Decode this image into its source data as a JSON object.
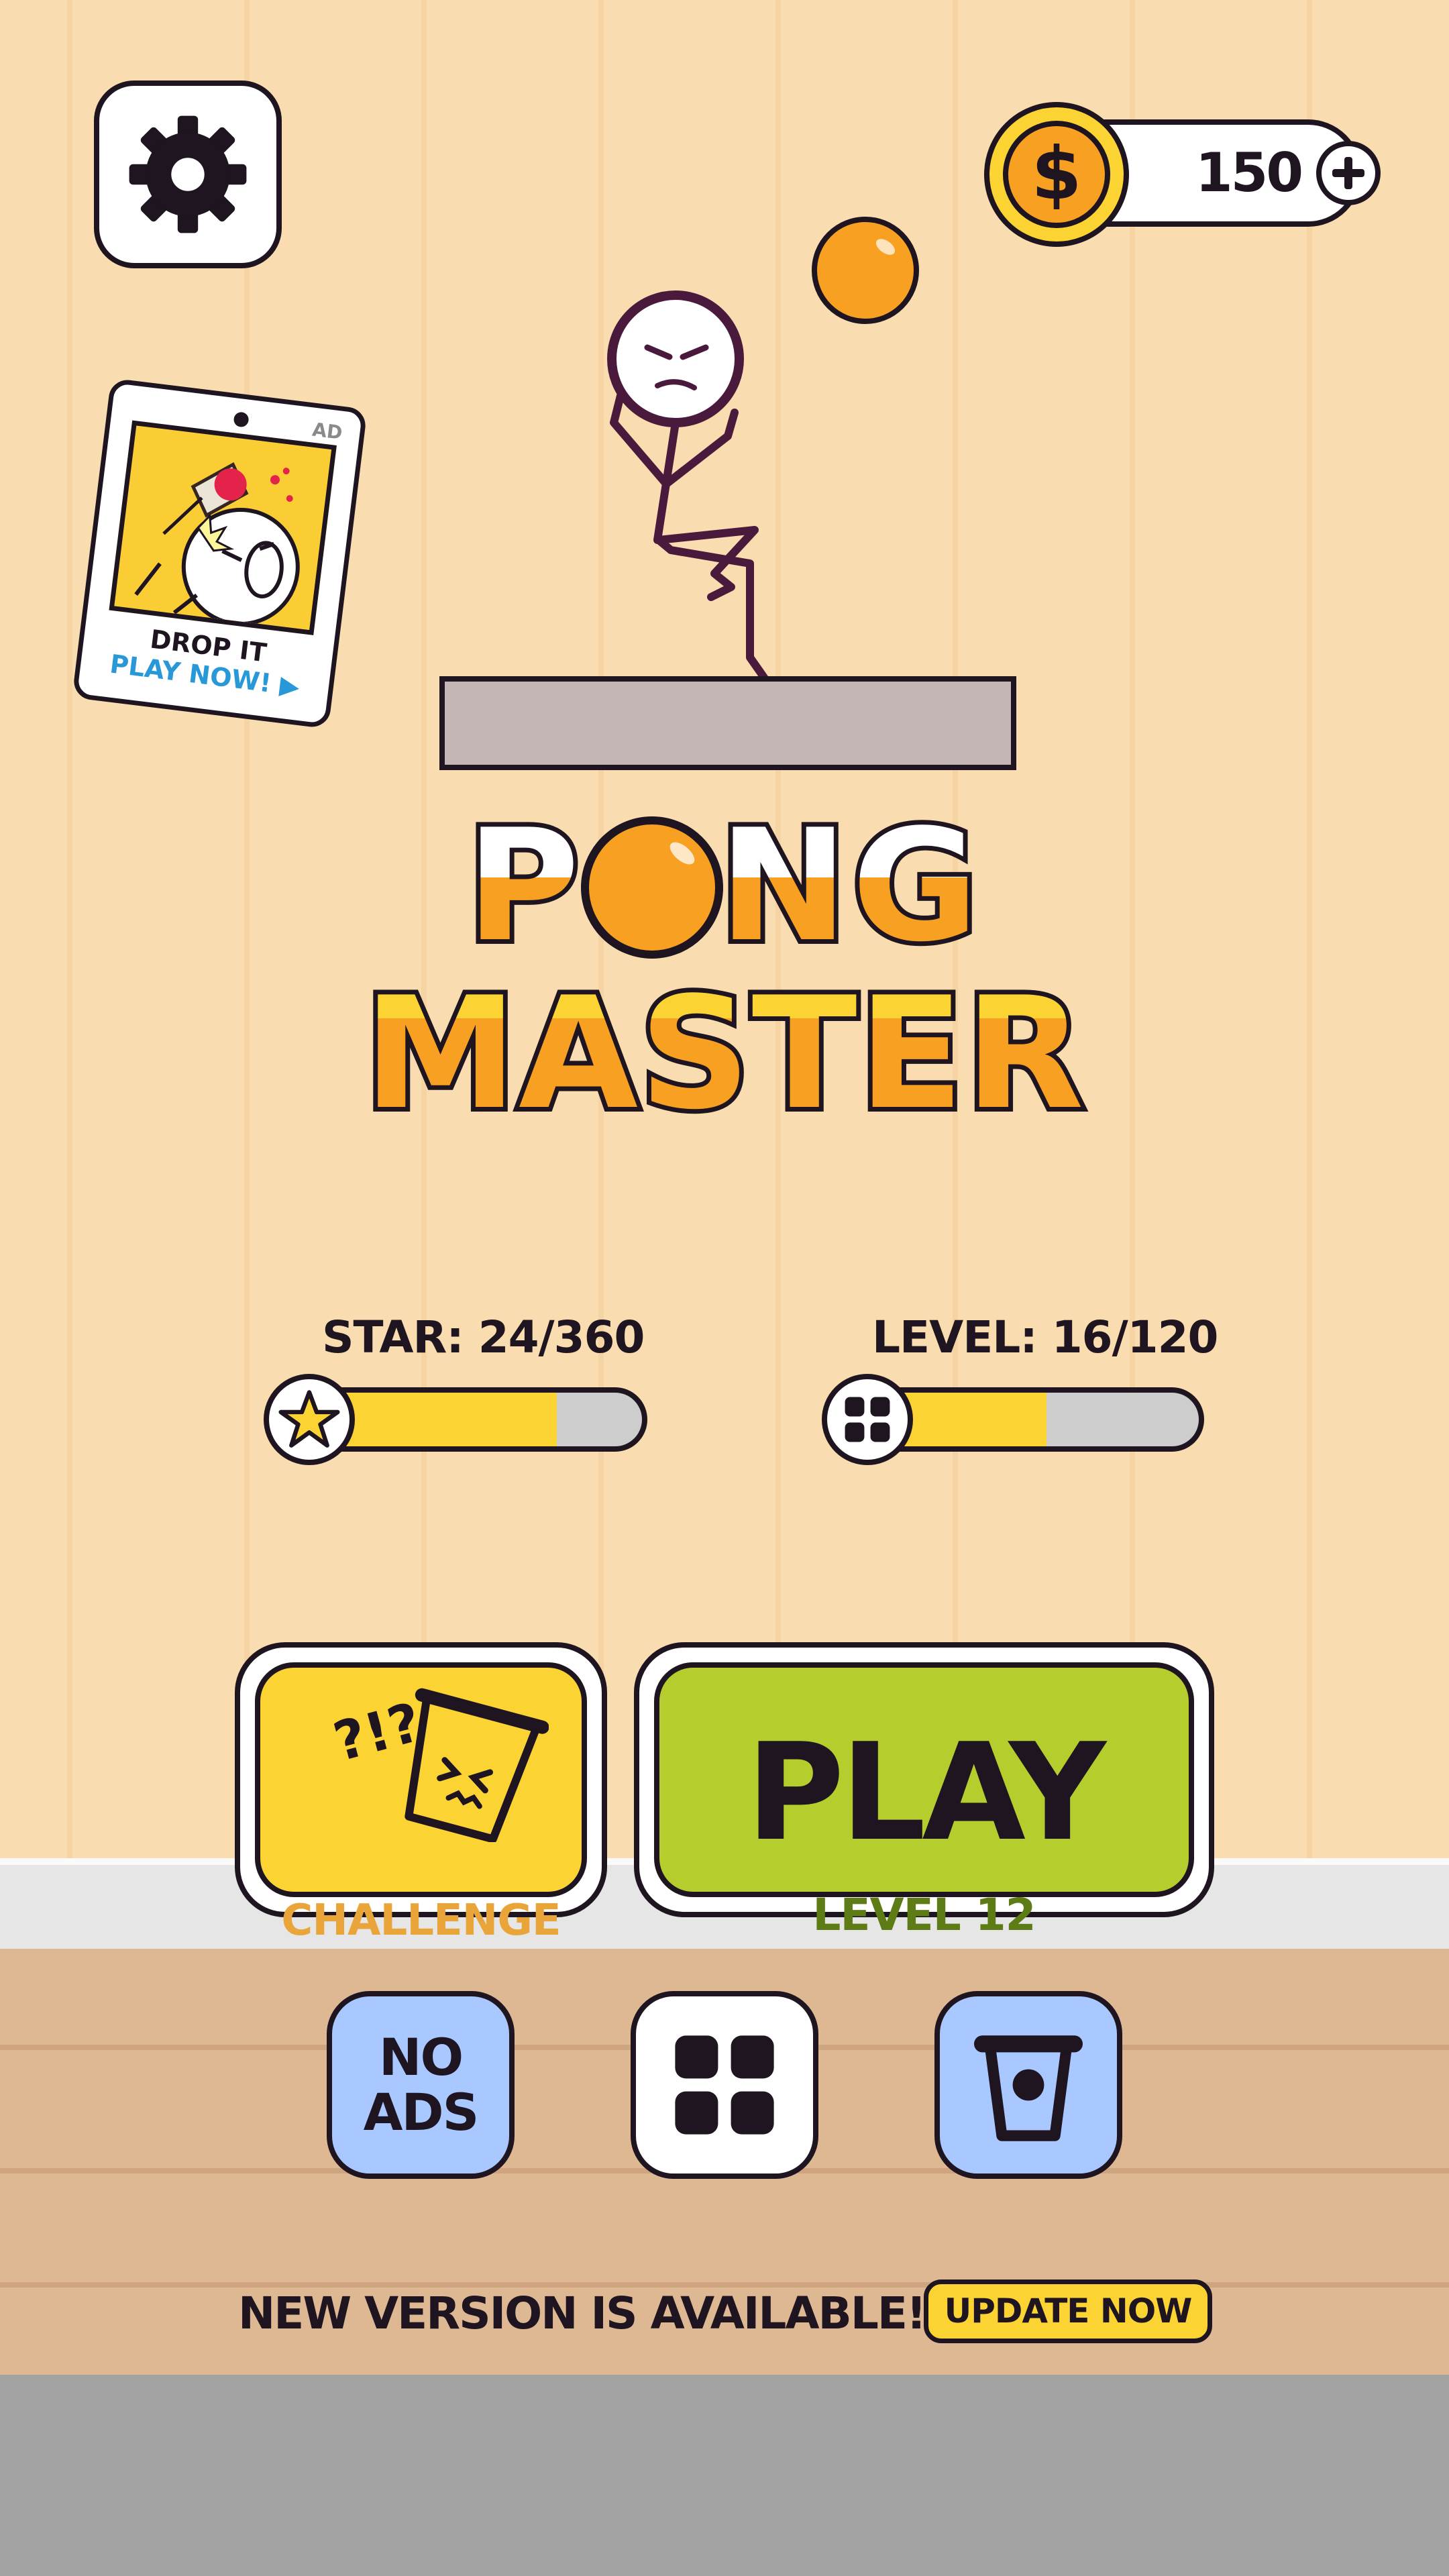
{
  "coins": {
    "amount": "150",
    "add_icon": "plus-icon",
    "coin_icon": "dollar-coin-icon"
  },
  "settings": {
    "icon": "gear-icon"
  },
  "ad": {
    "tag": "AD",
    "title": "DROP IT",
    "cta": "PLAY NOW! ▶"
  },
  "logo": {
    "line1": "PONG",
    "line2": "MASTER"
  },
  "stats": {
    "star": {
      "label": "STAR: 24/360",
      "value": 24,
      "max": 360,
      "progress": 0.75,
      "icon": "star-icon"
    },
    "level": {
      "label": "LEVEL: 16/120",
      "value": 16,
      "max": 120,
      "progress": 0.55,
      "icon": "grid-icon"
    }
  },
  "buttons": {
    "challenge": {
      "label": "CHALLENGE",
      "icon": "confused-cup-icon",
      "bg": "#fbd433"
    },
    "play": {
      "label": "PLAY",
      "sub": "LEVEL 12",
      "bg": "#b6cd2e"
    },
    "no_ads": {
      "label_1": "NO",
      "label_2": "ADS",
      "bg": "#a8c8ff"
    },
    "levels": {
      "icon": "grid-icon"
    },
    "cups": {
      "icon": "cup-icon",
      "bg": "#a8c8ff"
    }
  },
  "update": {
    "message": "NEW VERSION IS AVAILABLE!",
    "button": "UPDATE NOW"
  },
  "colors": {
    "wall": "#f9dcaf",
    "floor": "#ddb893",
    "accent": "#fbd433",
    "orange": "#f7a021",
    "outline": "#1e1520"
  }
}
